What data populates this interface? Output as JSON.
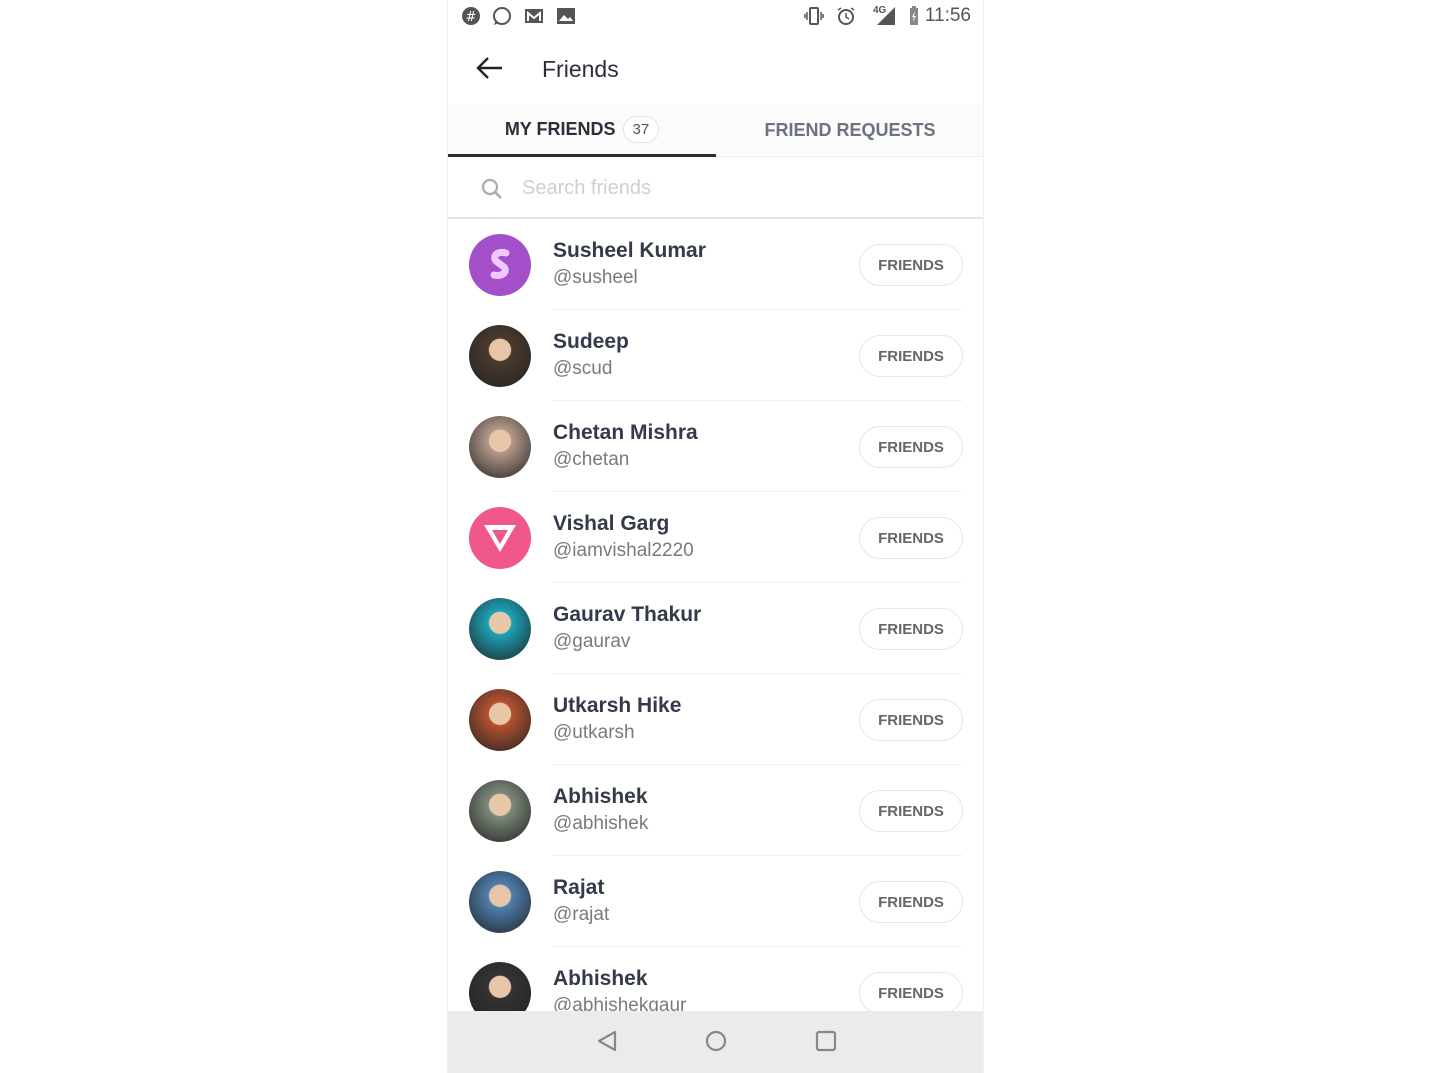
{
  "status_bar": {
    "time": "11:56",
    "network": "4G",
    "left_icons": [
      "slack-icon",
      "whatsapp-icon",
      "gmail-icon",
      "gallery-icon"
    ],
    "right_icons": [
      "vibrate-icon",
      "alarm-icon",
      "signal-icon",
      "battery-icon"
    ]
  },
  "header": {
    "title": "Friends",
    "back_icon": "arrow-left-icon"
  },
  "tabs": [
    {
      "label": "MY FRIENDS",
      "count": "37",
      "active": true
    },
    {
      "label": "FRIEND REQUESTS",
      "active": false
    }
  ],
  "search": {
    "placeholder": "Search friends",
    "value": ""
  },
  "friends": [
    {
      "name": "Susheel Kumar",
      "handle": "@susheel",
      "button": "FRIENDS",
      "avatar": "purple-s-logo",
      "color": "#a24fc9"
    },
    {
      "name": "Sudeep",
      "handle": "@scud",
      "button": "FRIENDS",
      "avatar": "photo",
      "color": "#4a3a2e"
    },
    {
      "name": "Chetan Mishra",
      "handle": "@chetan",
      "button": "FRIENDS",
      "avatar": "photo",
      "color": "#b59a8a"
    },
    {
      "name": "Vishal Garg",
      "handle": "@iamvishal2220",
      "button": "FRIENDS",
      "avatar": "pink-triangle-logo",
      "color": "#f0588a"
    },
    {
      "name": "Gaurav Thakur",
      "handle": "@gaurav",
      "button": "FRIENDS",
      "avatar": "cartoon",
      "color": "#1aa3b8"
    },
    {
      "name": "Utkarsh Hike",
      "handle": "@utkarsh",
      "button": "FRIENDS",
      "avatar": "photo",
      "color": "#b4522f"
    },
    {
      "name": "Abhishek",
      "handle": "@abhishek",
      "button": "FRIENDS",
      "avatar": "photo",
      "color": "#7d8a7a"
    },
    {
      "name": "Rajat",
      "handle": "@rajat",
      "button": "FRIENDS",
      "avatar": "photo",
      "color": "#4f7fb0"
    },
    {
      "name": "Abhishek",
      "handle": "@abhishekgaur",
      "button": "FRIENDS",
      "avatar": "photo",
      "color": "#333333"
    }
  ],
  "nav_bar": [
    "back-triangle-icon",
    "home-circle-icon",
    "recents-square-icon"
  ]
}
